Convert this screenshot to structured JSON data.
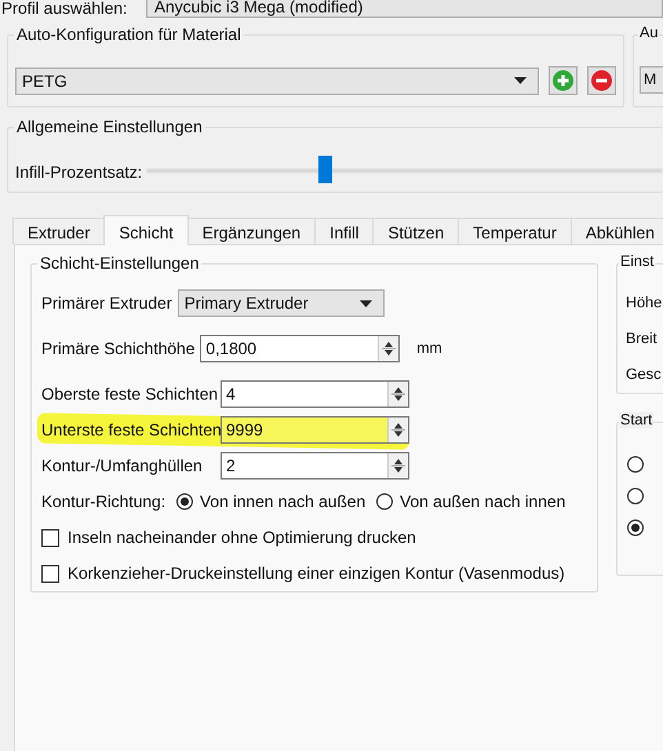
{
  "profile": {
    "label": "Profil auswählen:",
    "value": "Anycubic i3 Mega (modified)"
  },
  "material_group": {
    "title": "Auto-Konfiguration für Material",
    "value": "PETG"
  },
  "cut_group": {
    "title": "Au",
    "value": "M"
  },
  "general_group": {
    "title": "Allgemeine Einstellungen",
    "slider": {
      "label": "Infill-Prozentsatz:",
      "level": 0.35
    }
  },
  "tabs": [
    {
      "label": "Extruder",
      "selected": false
    },
    {
      "label": "Schicht",
      "selected": true
    },
    {
      "label": "Ergänzungen",
      "selected": false
    },
    {
      "label": "Infill",
      "selected": false
    },
    {
      "label": "Stützen",
      "selected": false
    },
    {
      "label": "Temperatur",
      "selected": false
    },
    {
      "label": "Abkühlen",
      "selected": false
    }
  ],
  "layer_group": {
    "title": "Schicht-Einstellungen",
    "rows": [
      {
        "kind": "dropdown",
        "label": "Primärer Extruder",
        "value": "Primary Extruder"
      },
      {
        "kind": "spin",
        "label": "Primäre Schichthöhe",
        "value": "0,1800",
        "unit": "mm",
        "highlighted": false
      },
      {
        "kind": "spin",
        "label": "Oberste feste Schichten",
        "value": "4",
        "highlighted": false
      },
      {
        "kind": "spin",
        "label": "Unterste feste Schichten",
        "value": "9999",
        "highlighted": true
      },
      {
        "kind": "spin",
        "label": "Kontur-/Umfanghüllen",
        "value": "2",
        "highlighted": false
      },
      {
        "kind": "radio",
        "label": "Kontur-Richtung:",
        "options": [
          {
            "label": "Von innen nach außen",
            "selected": true
          },
          {
            "label": "Von außen nach innen",
            "selected": false
          }
        ]
      },
      {
        "kind": "checkbox",
        "label": "Inseln nacheinander ohne Optimierung drucken",
        "checked": false
      },
      {
        "kind": "checkbox",
        "label": "Korkenzieher-Druckeinstellung einer einzigen Kontur (Vasenmodus)",
        "checked": false
      }
    ]
  },
  "side_group": {
    "title": "Einst",
    "items": [
      "Höhe",
      "Breit",
      "Gesc"
    ]
  },
  "start_group": {
    "title": "Start",
    "options": [
      {
        "selected": false
      },
      {
        "selected": false
      },
      {
        "selected": true
      }
    ]
  }
}
